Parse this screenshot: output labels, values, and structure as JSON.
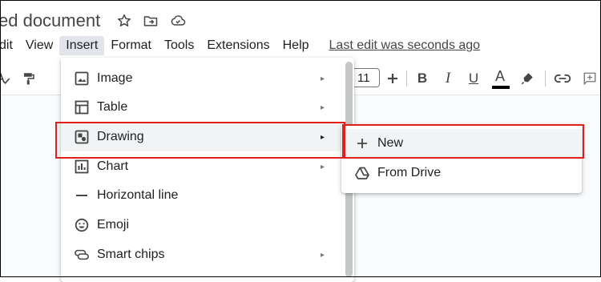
{
  "document": {
    "title": "ed document"
  },
  "title_icons": [
    "star-icon",
    "move-to-folder-icon",
    "cloud-status-icon"
  ],
  "menubar": {
    "items": [
      {
        "label": "dit"
      },
      {
        "label": "View"
      },
      {
        "label": "Insert"
      },
      {
        "label": "Format"
      },
      {
        "label": "Tools"
      },
      {
        "label": "Extensions"
      },
      {
        "label": "Help"
      }
    ],
    "last_edit": "Last edit was seconds ago"
  },
  "toolbar": {
    "font_size": "11",
    "bold": "B",
    "italic": "I",
    "underline": "U",
    "text_color_glyph": "A"
  },
  "insert_menu": {
    "items": [
      {
        "label": "Image",
        "icon": "image-icon",
        "arrow": "▸"
      },
      {
        "label": "Table",
        "icon": "table-icon",
        "arrow": "▸"
      },
      {
        "label": "Drawing",
        "icon": "drawing-icon",
        "arrow": "▸"
      },
      {
        "label": "Chart",
        "icon": "chart-icon",
        "arrow": "▸"
      },
      {
        "label": "Horizontal line",
        "icon": "horizontal-line-icon"
      },
      {
        "label": "Emoji",
        "icon": "emoji-icon"
      },
      {
        "label": "Smart chips",
        "icon": "smart-chips-icon",
        "arrow": "▸"
      }
    ]
  },
  "drawing_submenu": {
    "items": [
      {
        "label": "New",
        "icon": "plus-icon"
      },
      {
        "label": "From Drive",
        "icon": "drive-icon"
      }
    ]
  },
  "colors": {
    "annotation_red": "#e0201b",
    "menu_highlight": "#f1f3f4",
    "text": "#202124"
  }
}
